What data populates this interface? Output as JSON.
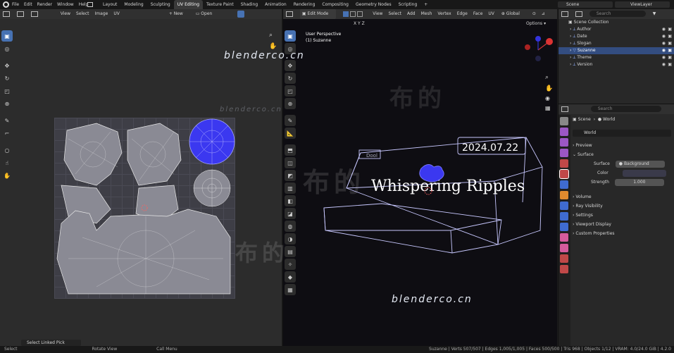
{
  "topbar": {
    "menu": [
      "File",
      "Edit",
      "Render",
      "Window",
      "Help"
    ],
    "workspaces": [
      "Layout",
      "Modeling",
      "Sculpting",
      "UV Editing",
      "Texture Paint",
      "Shading",
      "Animation",
      "Rendering",
      "Compositing",
      "Geometry Nodes",
      "Scripting",
      "+"
    ],
    "active_workspace": "UV Editing",
    "scene": "Scene",
    "viewlayer": "ViewLayer"
  },
  "uv_editor": {
    "menu": [
      "View",
      "Select",
      "Image",
      "UV"
    ],
    "new_label": "New",
    "open_label": "Open"
  },
  "viewport": {
    "mode": "Edit Mode",
    "menu": [
      "View",
      "Select",
      "Add",
      "Mesh",
      "Vertex",
      "Edge",
      "Face",
      "UV"
    ],
    "transform": "Global",
    "axes": [
      "X",
      "Y",
      "Z"
    ],
    "options": "Options",
    "perspective": "User Perspective",
    "object": "(1) Suzanne",
    "scene_text_date": "2024.07.22",
    "scene_text_title": "Whispering Ripples",
    "scene_text_small": "Dool"
  },
  "watermarks": {
    "site": "blenderco.cn",
    "cn": "布的"
  },
  "outliner": {
    "search_placeholder": "Search",
    "collection": "Scene Collection",
    "items": [
      "Author",
      "Date",
      "Slogan",
      "Suzanne",
      "Theme",
      "Version"
    ],
    "selected": "Suzanne"
  },
  "properties": {
    "search_placeholder": "Search",
    "breadcrumb": [
      "Scene",
      "World"
    ],
    "world_name": "World",
    "panels": [
      "Preview",
      "Surface",
      "Volume",
      "Ray Visibility",
      "Settings",
      "Viewport Display",
      "Custom Properties"
    ],
    "surface_label": "Surface",
    "surface_value": "Background",
    "color_label": "Color",
    "strength_label": "Strength",
    "strength_value": "1.000"
  },
  "status": {
    "tooltip": "Select Linked Pick",
    "items": [
      "Select",
      "Rotate View",
      "Call Menu"
    ],
    "stats": "Suzanne | Verts 507/507 | Edges 1,005/1,005 | Faces 500/500 | Tris 968 | Objects 1/12 | VRAM: 4.0/24.0 GiB | 4.2.0"
  },
  "colors": {
    "accent": "#4772b3",
    "uv_selected": "#3b38f0",
    "wire": "#c8c8ff",
    "grid_bg": "#3e3e46"
  }
}
